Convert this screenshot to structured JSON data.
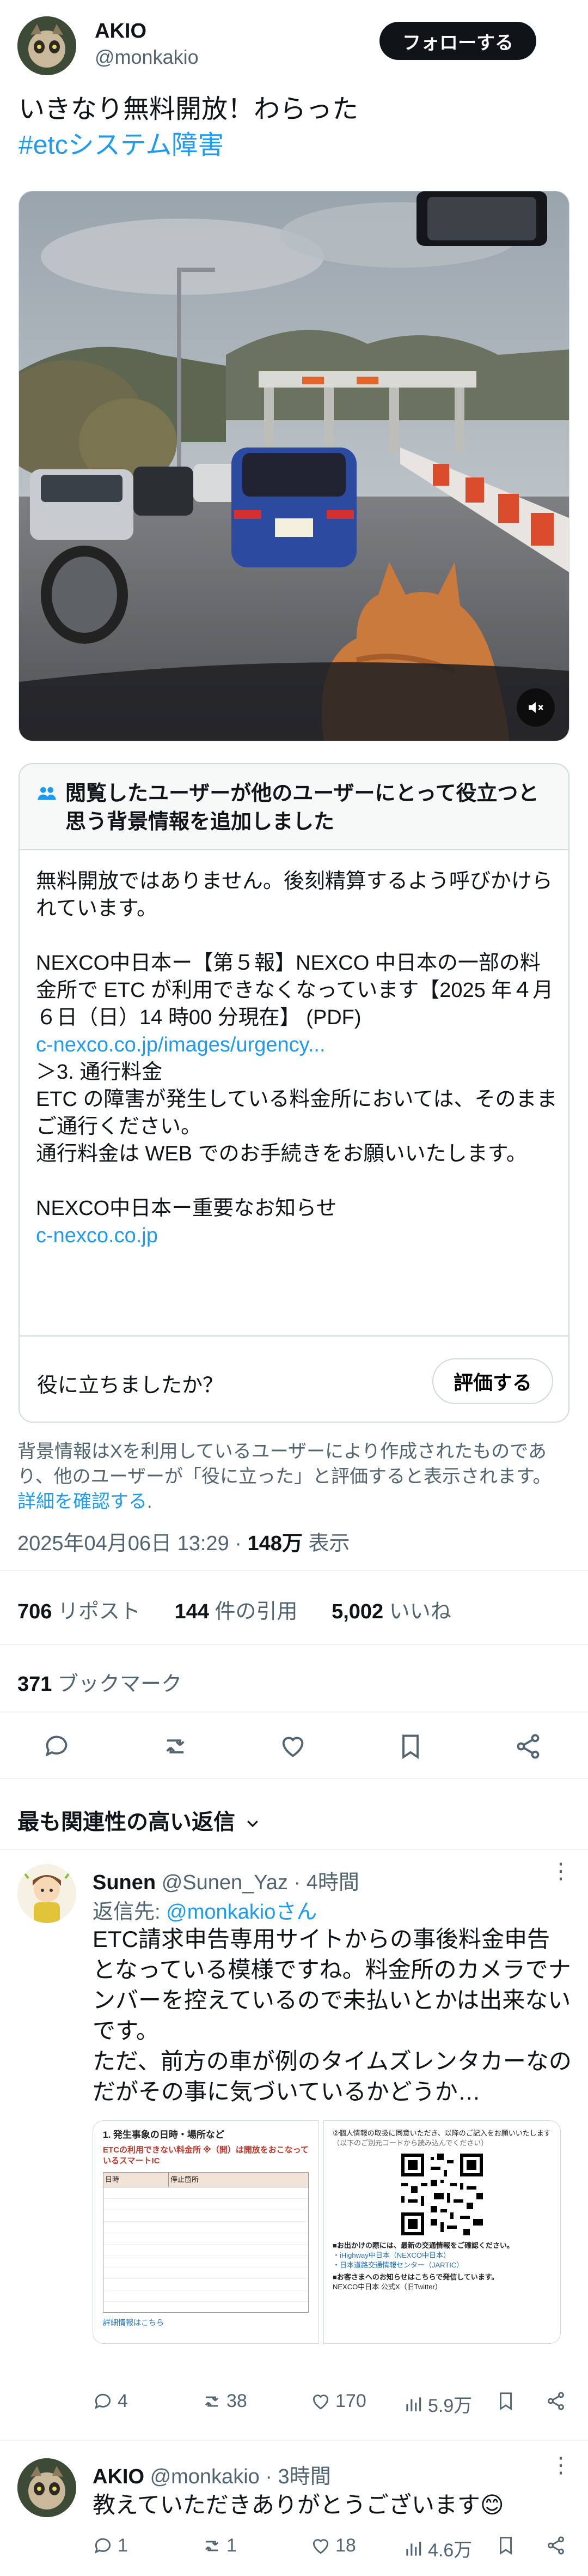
{
  "author": {
    "name": "AKIO",
    "handle": "@monkakio",
    "follow_label": "フォローする"
  },
  "tweet": {
    "text": "いきなり無料開放！わらった",
    "hashtag": "#etcシステム障害"
  },
  "note": {
    "header": "閲覧したユーザーが他のユーザーにとって役立つと思う背景情報を追加しました",
    "body_1": "無料開放ではありません。後刻精算するよう呼びかけられています。",
    "body_2": "NEXCO中日本ー【第５報】NEXCO 中日本の一部の料金所で ETC が利用できなくなっています【2025 年４月６日（日）14 時00 分現在】 (PDF)",
    "link_1": "c-nexco.co.jp/images/urgency...",
    "body_3": "＞3. 通行料金",
    "body_4": "ETC の障害が発生している料金所においては、そのままご通行ください。",
    "body_5": "通行料金は WEB でのお手続きをお願いいたします。",
    "body_6": "NEXCO中日本ー重要なお知らせ",
    "link_2": "c-nexco.co.jp",
    "question": "役に立ちましたか？",
    "rate_label": "評価する",
    "disclaimer": "背景情報はXを利用しているユーザーにより作成されたものであり、他のユーザーが「役に立った」と評価すると表示されます。",
    "disclaimer_link": "詳細を確認する"
  },
  "meta": {
    "datetime": "2025年04月06日 13:29",
    "separator": "·",
    "views_count": "148万",
    "views_label": "表示"
  },
  "stats": {
    "reposts_count": "706",
    "reposts_label": "リポスト",
    "quotes_count": "144",
    "quotes_label": "件の引用",
    "likes_count": "5,002",
    "likes_label": "いいね",
    "bookmarks_count": "371",
    "bookmarks_label": "ブックマーク"
  },
  "sort": {
    "label": "最も関連性の高い返信"
  },
  "replies": [
    {
      "name": "Sunen",
      "handle": "@Sunen_Yaz",
      "time": "· 4時間",
      "reply_to_label": "返信先: ",
      "reply_to_handle": "@monkakioさん",
      "text": "ETC請求申告専用サイトからの事後料金申告となっている模様ですね。料金所のカメラでナンバーを控えているので未払いとかは出来ないです。\nただ、前方の車が例のタイムズレンタカーなのだがその事に気づいているかどうか…",
      "img1": {
        "heading": "1. 発生事象の日時・場所など",
        "subheading": "ETCの利用できない料金所 ※（開）は開放をおこなっているスマートIC",
        "col1": "日時",
        "col2": "停止箇所",
        "footer_link": "詳細情報はこちら"
      },
      "img2": {
        "line1": "②個人情報の取扱に同意いただき、以降のご記入をお願いいたします",
        "line2": "（以下のご別元コードから読み込んでください）",
        "line3": "■お出かけの際には、最新の交通情報をご確認ください。",
        "line4": "・iHighway中日本（NEXCO中日本）",
        "line5": "・日本道路交通情報センター（JARTIC）",
        "line6": "■お客さまへのお知らせはこちらで発信しています。",
        "line7": "NEXCO中日本 公式X（旧Twitter）"
      },
      "actions": {
        "replies": "4",
        "reposts": "38",
        "likes": "170",
        "views": "5.9万"
      }
    },
    {
      "name": "AKIO",
      "handle": "@monkakio",
      "time": "· 3時間",
      "text": "教えていただきありがとうございます😊",
      "actions": {
        "replies": "1",
        "reposts": "1",
        "likes": "18",
        "views": "4.6万"
      }
    }
  ]
}
